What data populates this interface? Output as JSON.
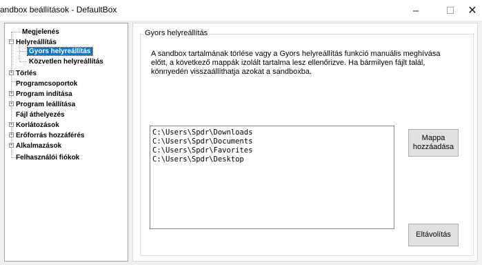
{
  "window": {
    "title": "andbox beállítások - DefaultBox",
    "minimize": "–",
    "maximize": "☐",
    "close": "✕"
  },
  "tree": {
    "items": [
      {
        "label": "Megjelenés"
      },
      {
        "label": "Helyreállítás"
      },
      {
        "label": "Gyors helyreállítás"
      },
      {
        "label": "Közvetlen helyreállítás"
      },
      {
        "label": "Törlés"
      },
      {
        "label": "Programcsoportok"
      },
      {
        "label": "Program indítása"
      },
      {
        "label": "Program leállítása"
      },
      {
        "label": "Fájl áthelyezés"
      },
      {
        "label": "Korlátozások"
      },
      {
        "label": "Erőforrás hozzáférés"
      },
      {
        "label": "Alkalmazások"
      },
      {
        "label": "Felhasználói fiókok"
      }
    ],
    "expander_collapsed": "+",
    "expander_expanded": "−"
  },
  "panel": {
    "group_title": "Gyors helyreállítás",
    "description_lines": [
      "A sandbox tartalmának törlése vagy a Gyors helyreállítás funkció manuális meghívása",
      "előtt, a következő mappák izolált tartalma lesz ellenőrizve.  Ha bármilyen fájlt talál,",
      "könnyedén visszaállíthatja azokat a sandboxba."
    ],
    "folders": [
      "C:\\Users\\Spdr\\Downloads",
      "C:\\Users\\Spdr\\Documents",
      "C:\\Users\\Spdr\\Favorites",
      "C:\\Users\\Spdr\\Desktop"
    ],
    "add_button_line1": "Mappa",
    "add_button_line2": "hozzáadása",
    "remove_button": "Eltávolítás"
  }
}
